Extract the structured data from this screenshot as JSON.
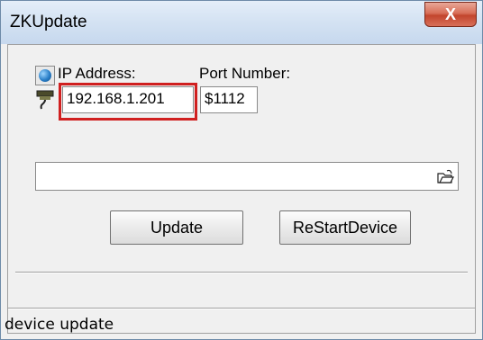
{
  "window": {
    "title": "ZKUpdate",
    "close_symbol": "X"
  },
  "connection": {
    "ip_label": "IP Address:",
    "ip_value": "192.168.1.201",
    "port_label": "Port Number:",
    "port_value": "$1112"
  },
  "file": {
    "path_value": ""
  },
  "buttons": {
    "update": "Update",
    "restart": "ReStartDevice"
  },
  "status": {
    "text": "device update"
  },
  "icons": [
    "globe-icon",
    "network-plug-icon",
    "open-folder-icon",
    "close-icon"
  ],
  "colors": {
    "highlight": "#d02020",
    "close_button": "#c2452d"
  }
}
